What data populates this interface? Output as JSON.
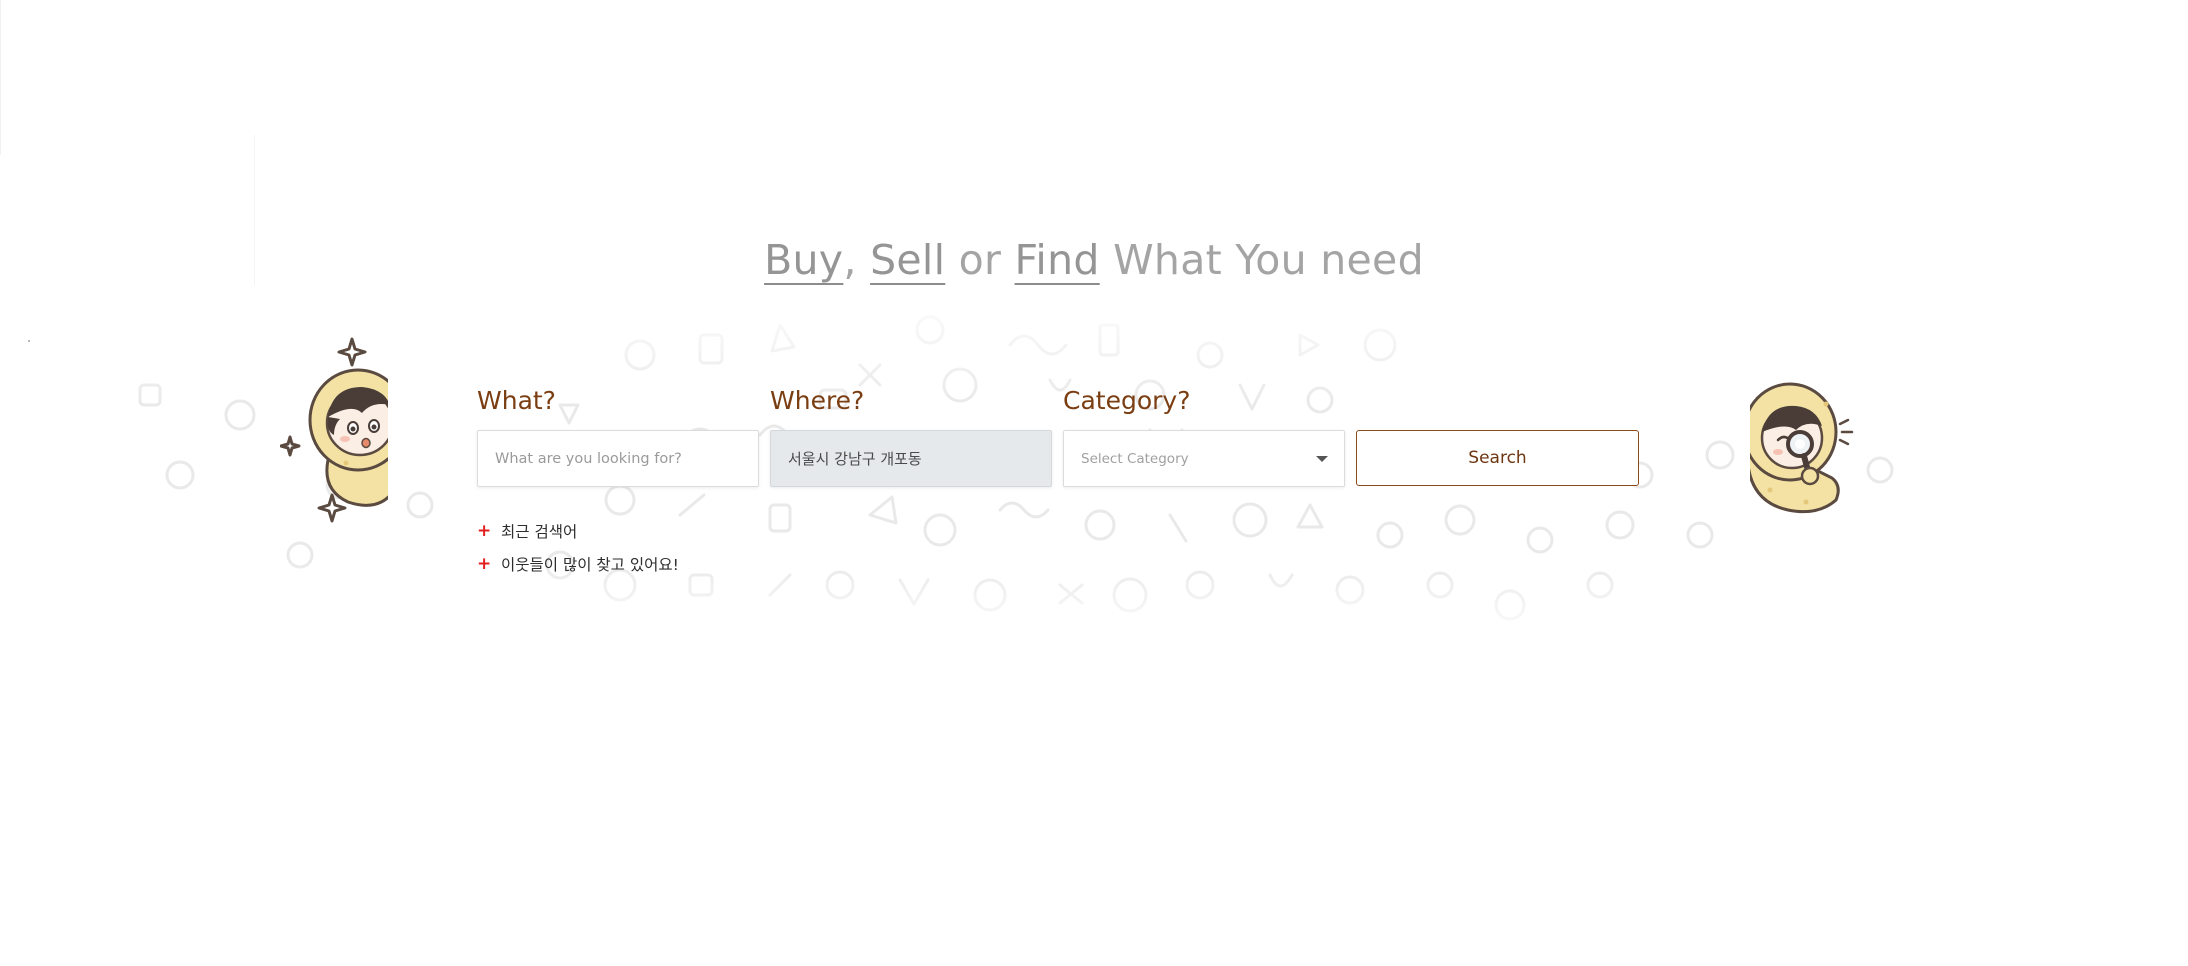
{
  "headline": {
    "buy": "Buy",
    "comma": ",",
    "sell": "Sell",
    "or": "or",
    "find": "Find",
    "rest": "What You need"
  },
  "search_form": {
    "what": {
      "label": "What?",
      "placeholder": "What are you looking for?"
    },
    "where": {
      "label": "Where?",
      "value": "서울시 강남구 개포동"
    },
    "category": {
      "label": "Category?",
      "placeholder": "Select Category"
    },
    "search_button": "Search"
  },
  "suggestions": [
    {
      "label": "최근 검색어",
      "icon": "plus-icon"
    },
    {
      "label": "이웃들이 많이 찾고 있어요!",
      "icon": "plus-icon"
    }
  ],
  "colors": {
    "brand_brown": "#7a3e12",
    "headline_grey": "#a4a4a4",
    "plus_red": "#e02020",
    "where_bg": "#e6e9ec",
    "mascot_yellow": "#f3e2a4"
  },
  "mascots": {
    "left": "peeking-character-with-sparkles",
    "right": "character-with-magnifying-glass"
  }
}
